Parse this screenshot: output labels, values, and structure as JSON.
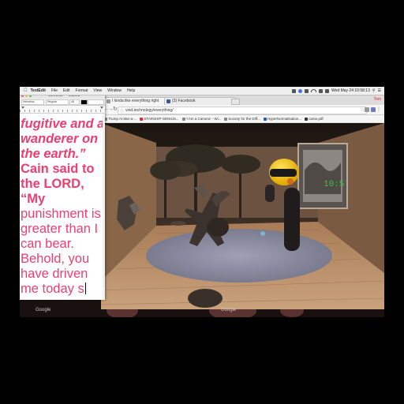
{
  "menubar": {
    "app_name": "TextEdit",
    "items": [
      "File",
      "Edit",
      "Format",
      "View",
      "Window",
      "Help"
    ],
    "datetime": "Wed May 24  10:58:13"
  },
  "textedit": {
    "doc_name": "Genesis — Edited",
    "font_family_field": "Helvetica",
    "font_style_field": "Regular",
    "font_size_field": "48",
    "text_color": "#ee3e6f",
    "lines": [
      {
        "text": "fugitive and a",
        "style": "bold-italic"
      },
      {
        "text": "wanderer on",
        "style": "bold-italic"
      },
      {
        "text": "the earth.”",
        "style": "bold-italic"
      },
      {
        "text": "Cain said to",
        "style": "bold"
      },
      {
        "text": "the LORD,",
        "style": "bold"
      },
      {
        "text": "“My",
        "style": "bold"
      },
      {
        "text": "punishment is",
        "style": "regular"
      },
      {
        "text": "greater than I",
        "style": "regular"
      },
      {
        "text": "can bear.",
        "style": "regular"
      },
      {
        "text": "Behold, you",
        "style": "regular"
      },
      {
        "text": "have driven",
        "style": "regular"
      },
      {
        "text": "me today s",
        "style": "regular"
      }
    ]
  },
  "browser": {
    "tabs": [
      {
        "label": "I kinda like everything right",
        "icon": "page-icon",
        "active": true
      },
      {
        "label": "(3) Facebook",
        "icon": "facebook-icon",
        "active": false
      }
    ],
    "profile": "Tom",
    "url": "void.technology/everything/",
    "bookmarks": [
      {
        "label": "Trump At Mar-a-...",
        "icon": "bookmark-icon"
      },
      {
        "label": "STARSHIP GENIUS...",
        "icon": "youtube-icon"
      },
      {
        "label": "'I Am a Camera' - Wi...",
        "icon": "wikipedia-icon"
      },
      {
        "label": "Society for the Diff...",
        "icon": "wikipedia-icon"
      },
      {
        "label": "HyperNormalisation...",
        "icon": "page-icon"
      },
      {
        "label": "carse.pdf",
        "icon": "pdf-icon"
      }
    ],
    "hud_time": "10:5"
  },
  "ghost_labels": [
    "Google",
    "Google"
  ],
  "colors": {
    "accent_pink": "#ee3e6f",
    "hud_green": "#34c23a",
    "floor_wood": "#b78a62",
    "platform": "#8d8ea2",
    "helmet_yellow": "#f3c51a"
  }
}
